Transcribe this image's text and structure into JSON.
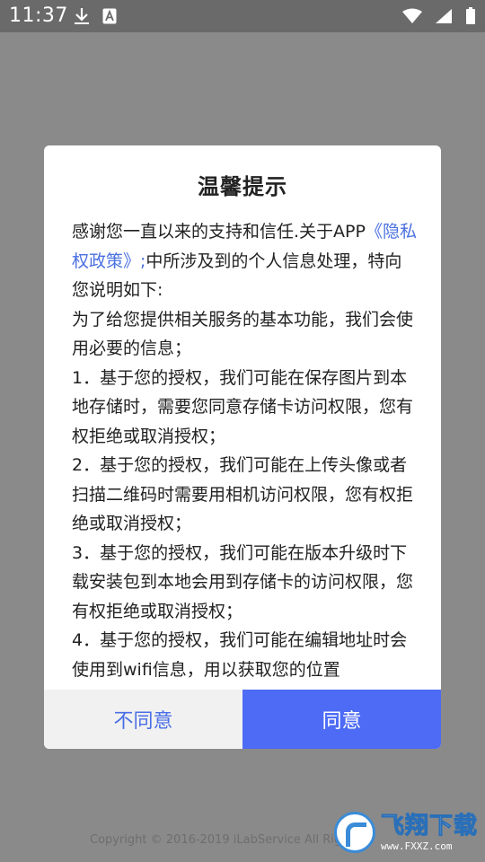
{
  "status_bar": {
    "time": "11:37",
    "icons": [
      "download-icon",
      "a-box-icon",
      "wifi-icon",
      "signal-icon",
      "battery-icon"
    ]
  },
  "dialog": {
    "title": "温馨提示",
    "intro_1": "感谢您一直以来的支持和信任.关于APP",
    "policy_link": "《隐私权政策》",
    "intro_2": ";中所涉及到的个人信息处理，特向您说明如下:",
    "paragraphs": [
      "为了给您提供相关服务的基本功能，我们会使用必要的信息；",
      "1．基于您的授权，我们可能在保存图片到本地存储时，需要您同意存储卡访问权限，您有权拒绝或取消授权；",
      "2．基于您的授权，我们可能在上传头像或者扫描二维码时需要用相机访问权限，您有权拒绝或取消授权；",
      "3．基于您的授权，我们可能在版本升级时下载安装包到本地会用到存储卡的访问权限，您有权拒绝或取消授权；",
      "4．基于您的授权，我们可能在编辑地址时会使用到wifi信息，用以获取您的位置"
    ],
    "disagree_label": "不同意",
    "agree_label": "同意"
  },
  "footer": {
    "copyright": "Copyright © 2016-2019 iLabService All Rights"
  },
  "watermark": {
    "brand": "飞翔下载",
    "url": "www.FXXZ.com"
  },
  "colors": {
    "accent": "#4d6bf5",
    "link": "#4a70e0",
    "overlay": "#8a8a8a"
  }
}
